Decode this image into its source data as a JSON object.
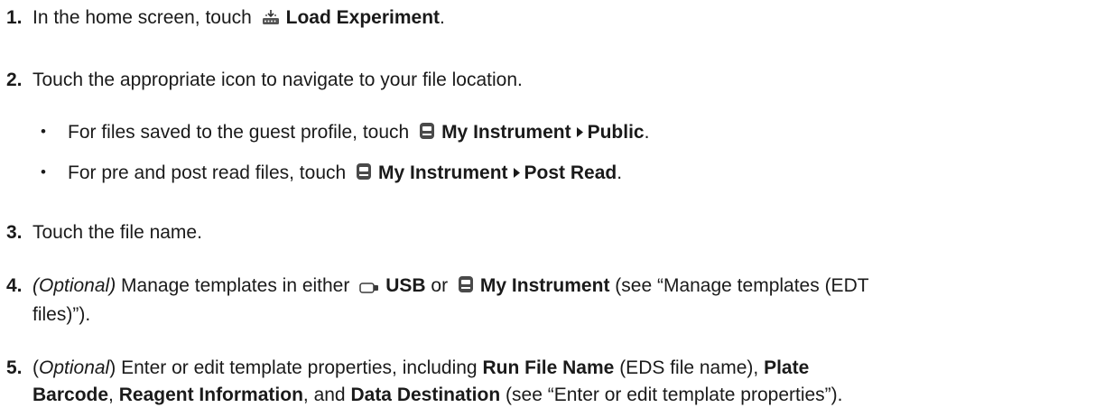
{
  "steps": [
    {
      "number": "1.",
      "parts": {
        "a": "In the home screen, touch",
        "icon": "load-experiment-icon",
        "b": "Load Experiment",
        "c": "."
      }
    },
    {
      "number": "2.",
      "parts": {
        "a": "Touch the appropriate icon to navigate to your file location."
      },
      "bullets": [
        {
          "a": "For files saved to the guest profile, touch",
          "icon": "instrument-icon",
          "b": "My Instrument",
          "arrow": "▸",
          "c": "Public",
          "d": "."
        },
        {
          "a": "For pre and post read files, touch",
          "icon": "instrument-icon",
          "b": "My Instrument",
          "arrow": "▸",
          "c": "Post Read",
          "d": "."
        }
      ]
    },
    {
      "number": "3.",
      "parts": {
        "a": "Touch the file name."
      }
    },
    {
      "number": "4.",
      "parts": {
        "optional": "(Optional)",
        "a": "Manage templates in either",
        "icon1": "usb-icon",
        "b": "USB",
        "c": "or",
        "icon2": "instrument-icon",
        "d": "My Instrument",
        "e": "(see “Manage templates (EDT",
        "f": "files)”)."
      }
    },
    {
      "number": "5.",
      "parts": {
        "p1": "(",
        "optional": "Optional",
        "p2": ")",
        "a": "Enter or edit template properties, including",
        "b": "Run File Name",
        "c": "(EDS file name),",
        "d": "Plate",
        "e": "Barcode",
        "f": ",",
        "g": "Reagent Information",
        "h": ", and",
        "i": "Data Destination",
        "j": "(see “Enter or edit template properties”)."
      }
    }
  ],
  "bullet_char": "•"
}
